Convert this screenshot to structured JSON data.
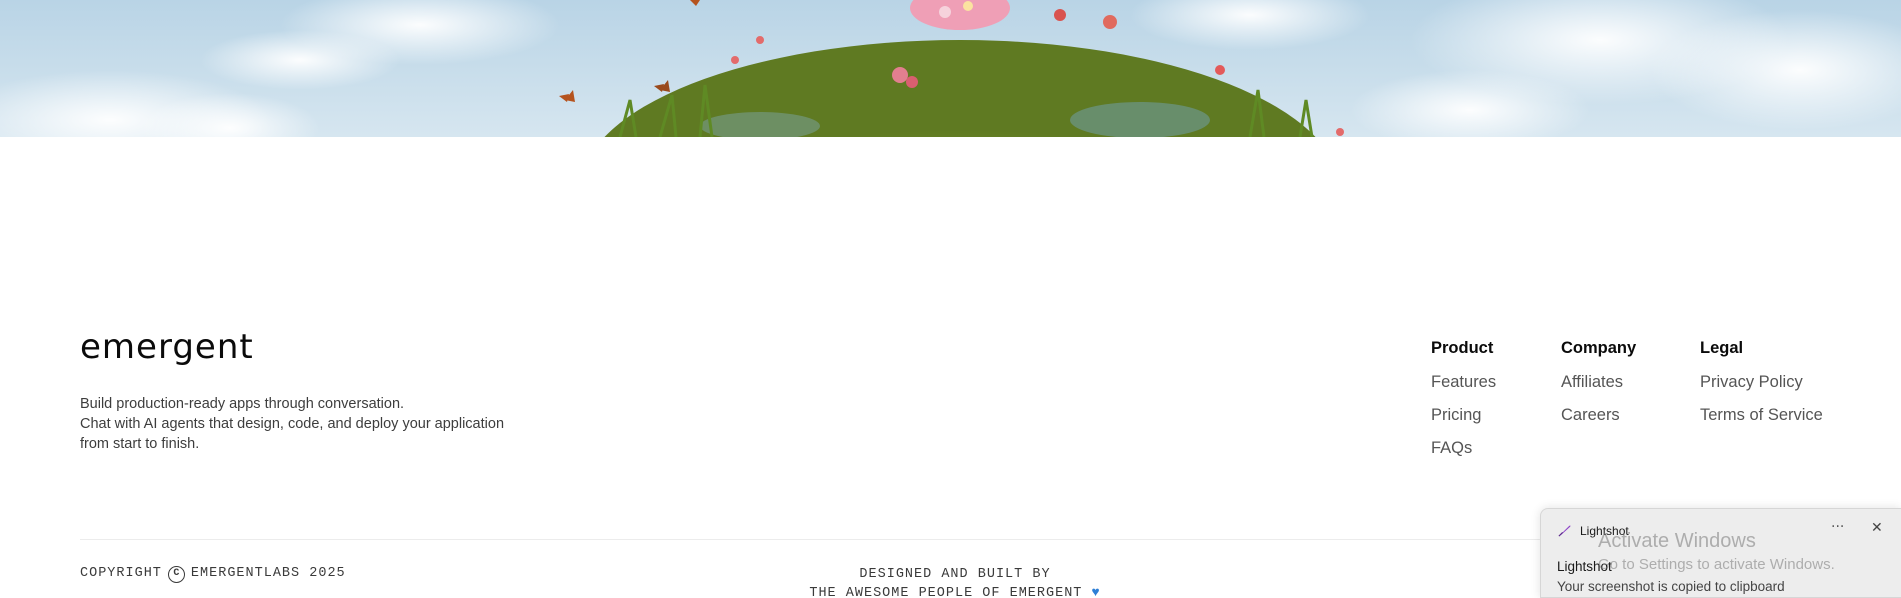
{
  "brand": {
    "name": "emergent"
  },
  "tagline": {
    "line1": "Build production-ready apps through conversation.",
    "line2": "Chat with AI agents that design, code, and deploy your application",
    "line3": "from start to finish."
  },
  "footer_nav": {
    "product": {
      "heading": "Product",
      "links": [
        "Features",
        "Pricing",
        "FAQs"
      ]
    },
    "company": {
      "heading": "Company",
      "links": [
        "Affiliates",
        "Careers"
      ]
    },
    "legal": {
      "heading": "Legal",
      "links": [
        "Privacy Policy",
        "Terms of Service"
      ]
    }
  },
  "copyright": {
    "prefix": "COPYRIGHT",
    "symbol": "C",
    "suffix": "EMERGENTLABS 2025"
  },
  "credits": {
    "line1": "DESIGNED AND BUILT BY",
    "line2": "THE AWESOME PEOPLE OF EMERGENT",
    "heart": "♥"
  },
  "toast": {
    "app_name": "Lightshot",
    "title": "Lightshot",
    "message": "Your screenshot is copied to clipboard",
    "more_glyph": "···",
    "close_glyph": "✕"
  },
  "watermark": {
    "line1": "Activate Windows",
    "line2": "Go to Settings to activate Windows."
  },
  "colors": {
    "sky": "#c6dcea",
    "grass": "#7f9a2e",
    "text_primary": "#0b0b0b",
    "text_secondary": "#555555",
    "toast_bg": "#ededed"
  }
}
